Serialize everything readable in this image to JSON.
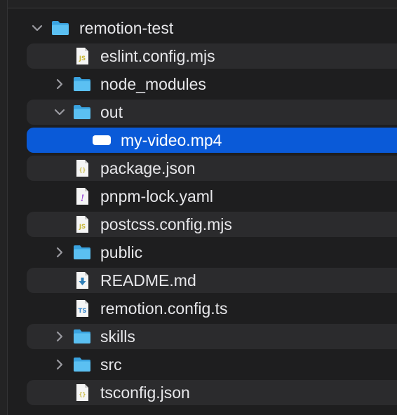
{
  "tree": {
    "root": {
      "label": "remotion-test",
      "icon": "folder-icon",
      "expanded": true
    },
    "items": [
      {
        "label": "eslint.config.mjs",
        "icon": "js-file-icon",
        "type": "file"
      },
      {
        "label": "node_modules",
        "icon": "folder-icon",
        "type": "folder",
        "expanded": false
      },
      {
        "label": "out",
        "icon": "folder-icon",
        "type": "folder",
        "expanded": true
      },
      {
        "label": "my-video.mp4",
        "icon": "video-file-icon",
        "type": "file",
        "selected": true
      },
      {
        "label": "package.json",
        "icon": "json-file-icon",
        "type": "file"
      },
      {
        "label": "pnpm-lock.yaml",
        "icon": "yaml-file-icon",
        "type": "file"
      },
      {
        "label": "postcss.config.mjs",
        "icon": "js-file-icon",
        "type": "file"
      },
      {
        "label": "public",
        "icon": "folder-icon",
        "type": "folder",
        "expanded": false
      },
      {
        "label": "README.md",
        "icon": "markdown-file-icon",
        "type": "file"
      },
      {
        "label": "remotion.config.ts",
        "icon": "ts-file-icon",
        "type": "file"
      },
      {
        "label": "skills",
        "icon": "folder-icon",
        "type": "folder",
        "expanded": false
      },
      {
        "label": "src",
        "icon": "folder-icon",
        "type": "folder",
        "expanded": false
      },
      {
        "label": "tsconfig.json",
        "icon": "json-file-icon",
        "type": "file"
      }
    ]
  },
  "colors": {
    "background": "#1e1e1f",
    "stripe": "#2b2b2d",
    "selection": "#0a5ad8",
    "folder": "#4fb3ea",
    "text": "#e7e7ea",
    "js_badge": "#c9b83a",
    "json_badge": "#c9b83a",
    "yaml_badge": "#a259d9",
    "ts_badge": "#3a87c9",
    "md_badge": "#2f7fb8"
  }
}
